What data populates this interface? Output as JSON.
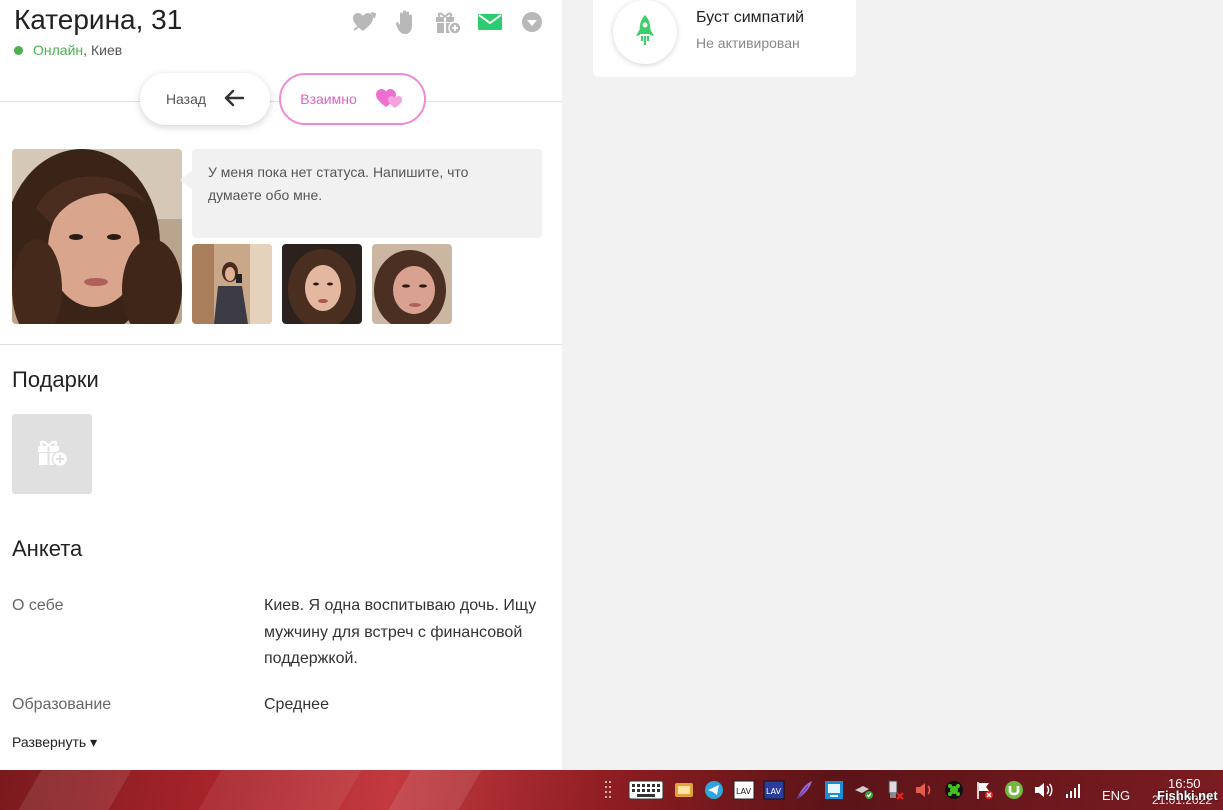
{
  "profile": {
    "name": "Катерина, 31",
    "online": "Онлайн",
    "city": "Киев"
  },
  "actions": {
    "back_label": "Назад",
    "mutual_label": "Взаимно"
  },
  "status_bubble": {
    "text": "У меня пока нет статуса. Напишите, что думаете обо мне."
  },
  "gifts": {
    "title": "Подарки"
  },
  "questionnaire": {
    "title": "Анкета",
    "rows": [
      {
        "label": "О себе",
        "value": "Киев. Я одна воспитываю дочь. Ищу мужчину для встреч с финансовой поддержкой."
      },
      {
        "label": "Образование",
        "value": "Среднее"
      }
    ],
    "expand_label": "Развернуть ▾"
  },
  "boost": {
    "title": "Буст симпатий",
    "status": "Не активирован"
  },
  "taskbar": {
    "language": "ENG",
    "time": "16:50",
    "date": "21.01.2022",
    "watermark": "Fishki.net"
  },
  "colors": {
    "accent_pink": "#f08ad6",
    "online_green": "#4caf50",
    "mail_green": "#2ecc71",
    "boost_green": "#3ccf6a"
  }
}
